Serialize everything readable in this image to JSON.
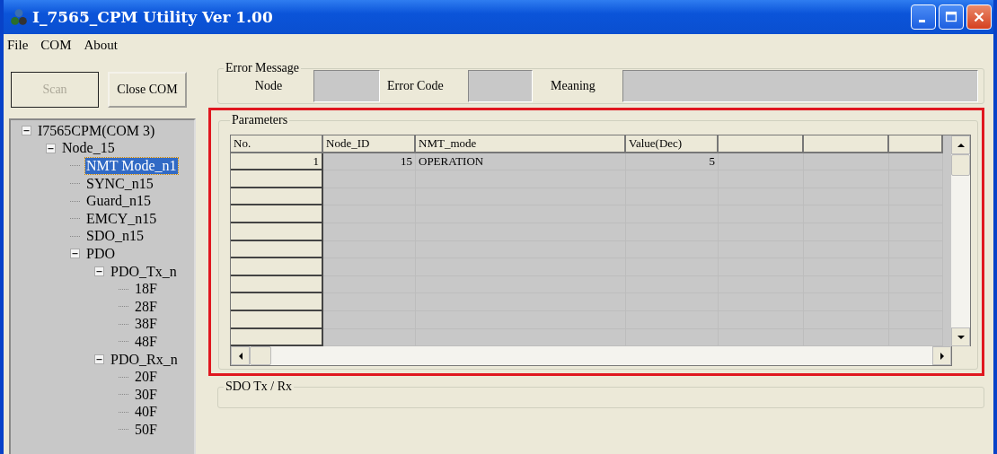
{
  "window": {
    "title": "I_7565_CPM Utility Ver 1.00"
  },
  "menu": [
    {
      "label": "File"
    },
    {
      "label": "COM"
    },
    {
      "label": "About"
    }
  ],
  "buttons": [
    {
      "label": "Scan",
      "disabled": true
    },
    {
      "label": "Close COM",
      "disabled": false
    }
  ],
  "tree": [
    {
      "label": "I7565CPM(COM 3)",
      "selected": false,
      "expanded": true,
      "children": [
        {
          "label": "Node_15",
          "selected": false,
          "expanded": true,
          "children": [
            {
              "label": "NMT Mode_n1",
              "selected": true
            },
            {
              "label": "SYNC_n15",
              "selected": false
            },
            {
              "label": "Guard_n15",
              "selected": false
            },
            {
              "label": "EMCY_n15",
              "selected": false
            },
            {
              "label": "SDO_n15",
              "selected": false
            },
            {
              "label": "PDO",
              "selected": false,
              "expanded": true,
              "children": [
                {
                  "label": "PDO_Tx_n",
                  "selected": false,
                  "expanded": true,
                  "children": [
                    {
                      "label": "18F",
                      "selected": false
                    },
                    {
                      "label": "28F",
                      "selected": false
                    },
                    {
                      "label": "38F",
                      "selected": false
                    },
                    {
                      "label": "48F",
                      "selected": false
                    }
                  ]
                },
                {
                  "label": "PDO_Rx_n",
                  "selected": false,
                  "expanded": true,
                  "children": [
                    {
                      "label": "20F",
                      "selected": false
                    },
                    {
                      "label": "30F",
                      "selected": false
                    },
                    {
                      "label": "40F",
                      "selected": false
                    },
                    {
                      "label": "50F",
                      "selected": false
                    }
                  ]
                }
              ]
            }
          ]
        }
      ]
    }
  ],
  "error_message": {
    "title": "Error Message",
    "node_label": "Node",
    "error_code_label": "Error Code",
    "meaning_label": "Meaning"
  },
  "parameters": {
    "title": "Parameters",
    "highlighted": true,
    "columns": [
      "No.",
      "Node_ID",
      "NMT_mode",
      "Value(Dec)"
    ],
    "rows": [
      [
        "1",
        "15",
        "OPERATION",
        "5"
      ]
    ]
  },
  "sdo_group": {
    "title": "SDO Tx / Rx"
  }
}
